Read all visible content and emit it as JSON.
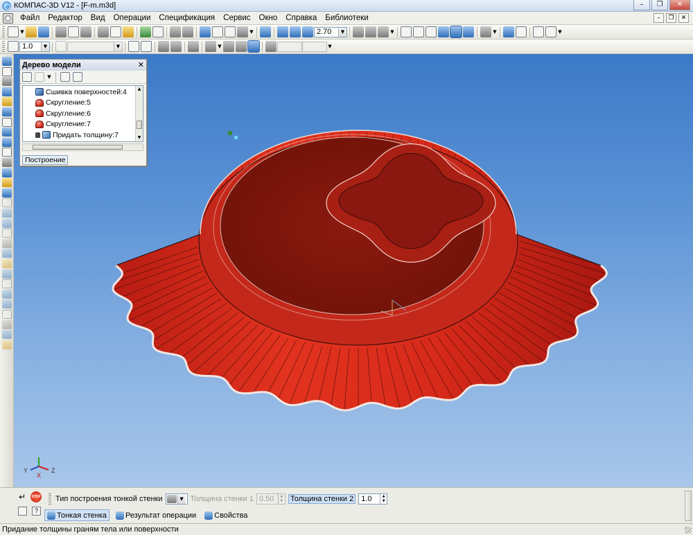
{
  "window": {
    "title": "КОМПАС-3D V12 - [F-m.m3d]"
  },
  "menu": {
    "items": [
      "Файл",
      "Редактор",
      "Вид",
      "Операции",
      "Спецификация",
      "Сервис",
      "Окно",
      "Справка",
      "Библиотеки"
    ]
  },
  "toolbar": {
    "zoom_value": "2.70",
    "step_value": "1.0"
  },
  "model_tree": {
    "title": "Дерево модели",
    "items": [
      {
        "label": "Сшивка поверхностей:4",
        "icon": "stitch-surfaces-icon"
      },
      {
        "label": "Скругление:5",
        "icon": "fillet-icon"
      },
      {
        "label": "Скругление:6",
        "icon": "fillet-icon"
      },
      {
        "label": "Скругление:7",
        "icon": "fillet-icon"
      },
      {
        "label": "Придать толщину:7",
        "icon": "thicken-icon",
        "locked": true
      }
    ],
    "tab": "Построение"
  },
  "properties": {
    "wall_type_label": "Тип построения тонкой стенки",
    "thickness1_label": "Толщина стенки 1",
    "thickness1_value": "0.50",
    "thickness2_label": "Толщина стенки 2",
    "thickness2_value": "1.0",
    "stop_label": "STOP",
    "tabs": [
      "Тонкая стенка",
      "Результат операции",
      "Свойства"
    ]
  },
  "axes": {
    "x": "X",
    "y": "Y",
    "z": "Z"
  },
  "status": {
    "text": "Придание толщины граням тела или поверхности"
  },
  "colors": {
    "model_red": "#c8251a",
    "viewport_top": "#3b79c7",
    "viewport_bottom": "#a8c7ea"
  }
}
